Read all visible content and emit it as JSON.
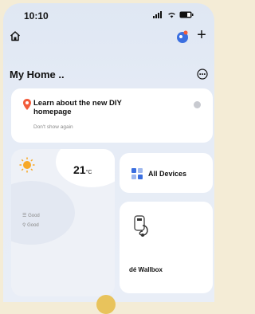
{
  "status_bar": {
    "time": "10:10"
  },
  "header": {
    "title": "My Home ..",
    "add_label": "+"
  },
  "banner": {
    "title": "Learn about the new DIY homepage",
    "dismiss": "Don't show again"
  },
  "weather": {
    "temperature": "21",
    "unit": "°C",
    "air_quality": "Good",
    "humidity": "Good"
  },
  "tiles": {
    "all_devices": "All Devices",
    "wallbox": "dé Wallbox"
  },
  "colors": {
    "accent": "#3b6fe0",
    "pin": "#f25c3b",
    "sun": "#f7a928"
  }
}
